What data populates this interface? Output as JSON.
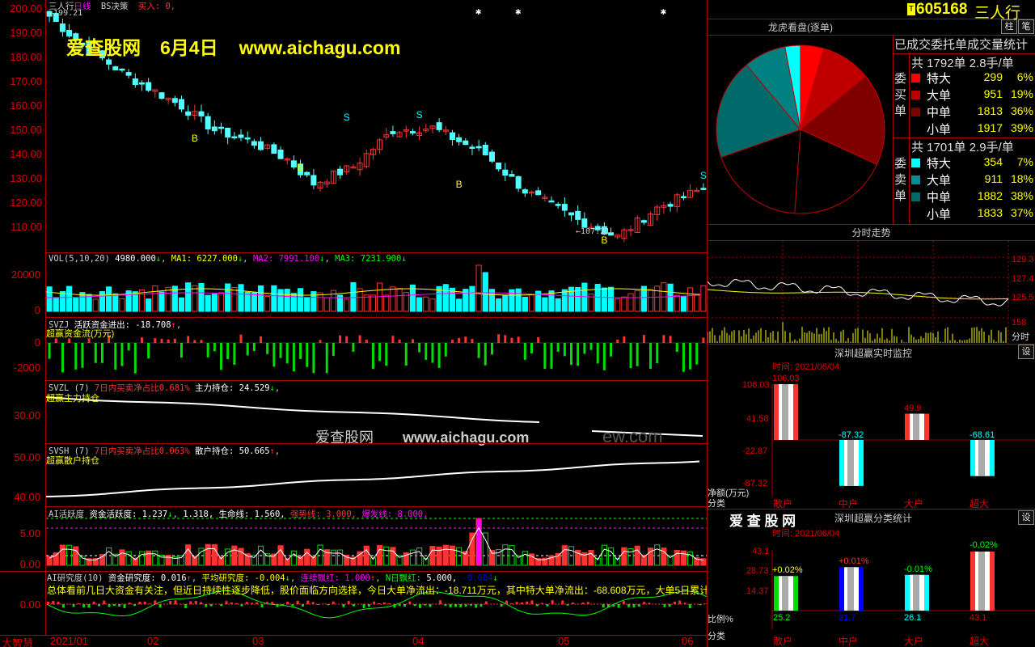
{
  "stock": {
    "code": "605168",
    "name": "三人行",
    "period": "日线",
    "indicator": "BS决策",
    "buy_label": "买入",
    "buy_value": "0,",
    "high_mark": "199.21",
    "low_mark": "107.21"
  },
  "watermark": {
    "site": "爱查股网",
    "date": "6月4日",
    "url": "www.aichagu.com",
    "mid_site": "爱查股网",
    "mid_url": "www.aichagu.com",
    "ghost": "ew.com"
  },
  "main_axis": [
    "200.00",
    "190.00",
    "180.00",
    "170.00",
    "160.00",
    "150.00",
    "140.00",
    "130.00",
    "120.00",
    "110.00"
  ],
  "vol": {
    "title": "VOL(5,10,20)",
    "value": "4980.000",
    "ma1_label": "MA1:",
    "ma1": "6227.000",
    "ma2_label": "MA2:",
    "ma2": "7991.100",
    "ma3_label": "MA3:",
    "ma3": "7231.900",
    "axis": [
      "20000",
      "10000",
      "0"
    ]
  },
  "svzj": {
    "title": "SVZJ",
    "label": "活跃资金进出:",
    "value": "-18.708",
    "subtitle": "超赢资金流(万元)",
    "axis": [
      "0",
      "-2000"
    ]
  },
  "svzl": {
    "title": "SVZL (7)",
    "desc": "7日内买卖净占比0.681%",
    "label": "主力持仓:",
    "value": "24.529",
    "subtitle": "超赢主力持仓",
    "axis": [
      "30.00"
    ]
  },
  "svsh": {
    "title": "SVSH (7)",
    "desc": "7日内买卖净占比0.063%",
    "label": "散户持仓:",
    "value": "50.665",
    "subtitle": "超赢散户持仓",
    "axis": [
      "50.00",
      "40.00"
    ]
  },
  "ai_act": {
    "title": "AI活跃度",
    "l1": "资金活跃度:",
    "v1": "1.237",
    "v2": "1.318,",
    "l3": "生命线:",
    "v3": "1.560,",
    "l4": "强势线:",
    "v4": "3.000,",
    "l5": "爆发线:",
    "v5": "8.000,",
    "axis": [
      "5.00",
      "0.00"
    ]
  },
  "ai_res": {
    "title": "AI研究度(10)",
    "l1": "资金研究度:",
    "v1": "0.016",
    "l2": "平均研究度:",
    "v2": "-0.004",
    "l3": "连续飘红:",
    "v3": "1.000",
    "l4": "N日飘红:",
    "v4": "5.000,",
    "v5": "-0.004",
    "summary": "总体看前几日大资金有关注，但近日持续性逐步降低，股价面临方向选择，今日大单净流出：-18.711万元，其中特大单净流出：-68.608万元，大单5日累计",
    "axis": [
      "0.00"
    ]
  },
  "bottom": {
    "app": "大智慧",
    "dates": [
      "2021/01",
      "02",
      "03",
      "04",
      "05",
      "06"
    ]
  },
  "longhu": {
    "title": "龙虎看盘(逐单)",
    "subtitle": "已成交委托单成交量统计",
    "buy_total": "共 1792单 2.8手/单",
    "buy_label": "委买单",
    "buy_rows": [
      {
        "name": "特大",
        "count": "299",
        "pct": "6%",
        "color": "#ff0000",
        "text": "#ffffff"
      },
      {
        "name": "大单",
        "count": "951",
        "pct": "19%",
        "color": "#c00000",
        "text": "#ffffff"
      },
      {
        "name": "中单",
        "count": "1813",
        "pct": "36%",
        "color": "#800000",
        "text": "#ffffff"
      },
      {
        "name": "小单",
        "count": "1917",
        "pct": "39%",
        "color": "#000000",
        "text": "#ffffff"
      }
    ],
    "sell_total": "共 1701单 2.9手/单",
    "sell_label": "委卖单",
    "sell_rows": [
      {
        "name": "特大",
        "count": "354",
        "pct": "7%",
        "color": "#00ffff",
        "text": "#ffffff"
      },
      {
        "name": "大单",
        "count": "911",
        "pct": "18%",
        "color": "#009090",
        "text": "#ffffff"
      },
      {
        "name": "中单",
        "count": "1882",
        "pct": "38%",
        "color": "#006a6a",
        "text": "#ffffff"
      },
      {
        "name": "小单",
        "count": "1833",
        "pct": "37%",
        "color": "#000000",
        "text": "#ffffff"
      }
    ],
    "colors": {
      "accent": "#ff0000",
      "cyan": "#00ffff",
      "yellow": "#ffff00"
    }
  },
  "fenshi": {
    "title": "分时走势",
    "axis": [
      "129.3",
      "127.4",
      "125.5"
    ],
    "vol_axis": [
      "158"
    ],
    "vol_label": "分时"
  },
  "monitor": {
    "title": "深圳超赢实时监控",
    "button": "设",
    "time": "时间: 2021/06/04",
    "axis": [
      "106.03",
      "41.58",
      "-22.87",
      "-87.32"
    ],
    "axis_name": "净额(万元)",
    "cat_label": "分类",
    "categories": [
      "散户",
      "中户",
      "大户",
      "超大"
    ],
    "values": [
      "106.03",
      "-87.32",
      "49.9",
      "-68.61"
    ]
  },
  "classify": {
    "brand": "爱 查 股 网",
    "title": "深圳超赢分类统计",
    "button": "设",
    "time": "时间: 2021/06/04",
    "axis": [
      "43.1",
      "28.73",
      "14.37"
    ],
    "ratio_label": "比例%",
    "cat_label": "分类",
    "categories": [
      "散户",
      "中户",
      "大户",
      "超大"
    ],
    "pcts": [
      "+0.02%",
      "+0.01%",
      "-0.01%",
      "-0.02%"
    ],
    "values": [
      "25.2",
      "31.7",
      "26.1",
      "43.1"
    ]
  },
  "toolbar": {
    "b1": "柱",
    "b2": "笔"
  },
  "chart_data": {
    "type": "bar",
    "title": "深圳超赢实时监控",
    "categories": [
      "散户",
      "中户",
      "大户",
      "超大"
    ],
    "series": [
      {
        "name": "净额(万元)",
        "values": [
          106.03,
          -87.32,
          49.9,
          -68.61
        ]
      }
    ],
    "ylim": [
      -87.32,
      106.03
    ]
  }
}
